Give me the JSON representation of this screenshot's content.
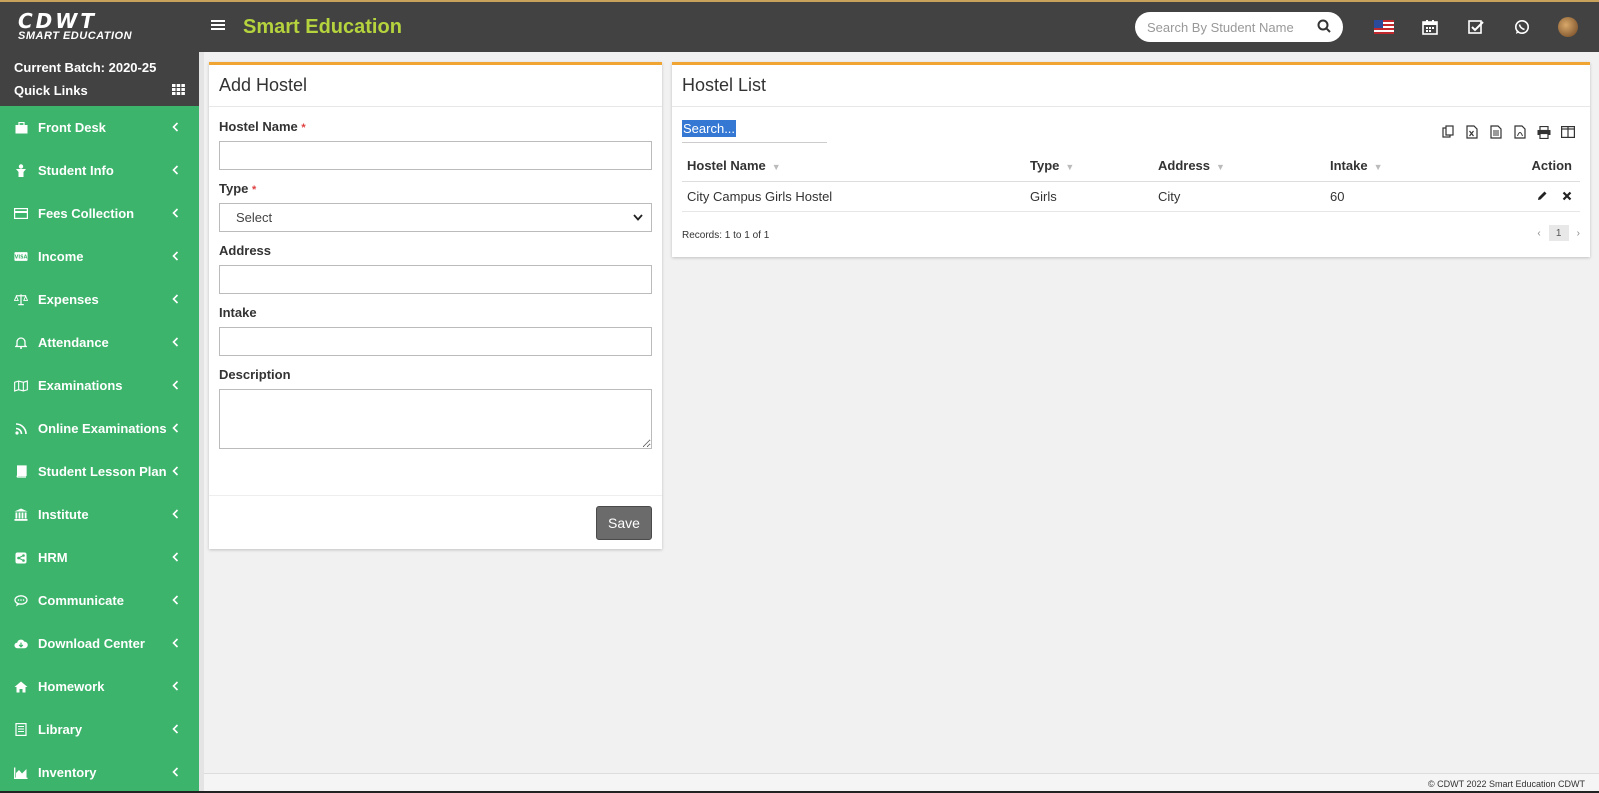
{
  "header": {
    "logo_line1": "CDWT",
    "logo_line2": "SMART EDUCATION",
    "app_title": "Smart Education",
    "search_placeholder": "Search By Student Name",
    "icons": [
      "us-flag-icon",
      "calendar-icon",
      "check-square-icon",
      "whatsapp-icon",
      "avatar"
    ]
  },
  "sidebar": {
    "current_batch": "Current Batch: 2020-25",
    "quick_links": "Quick Links",
    "items": [
      {
        "label": "Front Desk",
        "icon": "briefcase-icon"
      },
      {
        "label": "Student Info",
        "icon": "user-icon"
      },
      {
        "label": "Fees Collection",
        "icon": "credit-card-icon"
      },
      {
        "label": "Income",
        "icon": "visa-icon"
      },
      {
        "label": "Expenses",
        "icon": "balance-scale-icon"
      },
      {
        "label": "Attendance",
        "icon": "bell-icon"
      },
      {
        "label": "Examinations",
        "icon": "map-icon"
      },
      {
        "label": "Online Examinations",
        "icon": "rss-icon"
      },
      {
        "label": "Student Lesson Plan",
        "icon": "book-icon"
      },
      {
        "label": "Institute",
        "icon": "bank-icon"
      },
      {
        "label": "HRM",
        "icon": "share-icon"
      },
      {
        "label": "Communicate",
        "icon": "comment-icon"
      },
      {
        "label": "Download Center",
        "icon": "cloud-download-icon"
      },
      {
        "label": "Homework",
        "icon": "home-icon"
      },
      {
        "label": "Library",
        "icon": "library-icon"
      },
      {
        "label": "Inventory",
        "icon": "chart-area-icon"
      }
    ]
  },
  "add_form": {
    "title": "Add Hostel",
    "hostel_name_label": "Hostel Name",
    "type_label": "Type",
    "type_selected": "Select",
    "address_label": "Address",
    "intake_label": "Intake",
    "description_label": "Description",
    "required_mark": "*",
    "save_label": "Save"
  },
  "hostel_list": {
    "title": "Hostel List",
    "search_placeholder": "Search...",
    "columns": [
      "Hostel Name",
      "Type",
      "Address",
      "Intake",
      "Action"
    ],
    "rows": [
      {
        "name": "City Campus Girls Hostel",
        "type": "Girls",
        "address": "City",
        "intake": "60"
      }
    ],
    "records": "Records: 1 to 1 of 1",
    "page": "1",
    "prev": "‹",
    "next": "›"
  },
  "footer": {
    "text": "© CDWT 2022 Smart Education CDWT"
  },
  "colors": {
    "header_bg": "#424242",
    "sidebar_bg": "#3cb46b",
    "title_accent": "#b5d33d",
    "panel_border": "#f0a431"
  }
}
